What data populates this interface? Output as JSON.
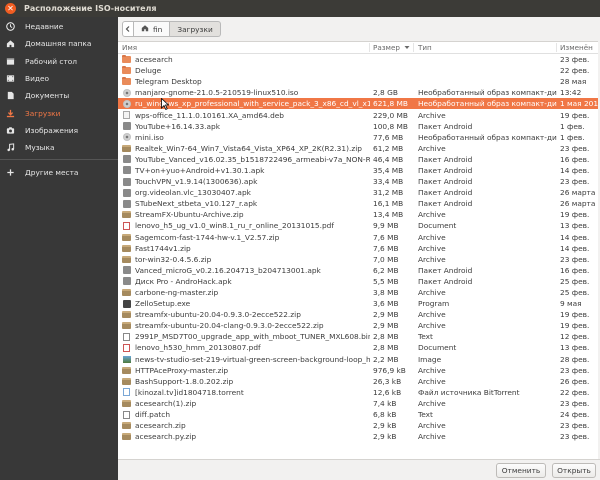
{
  "window": {
    "title": "Расположение ISO-носителя"
  },
  "sidebar": {
    "items": [
      {
        "label": "Недавние",
        "icon": "clock-icon"
      },
      {
        "label": "Домашняя папка",
        "icon": "home-icon"
      },
      {
        "label": "Рабочий стол",
        "icon": "desktop-icon"
      },
      {
        "label": "Видео",
        "icon": "video-icon"
      },
      {
        "label": "Документы",
        "icon": "documents-icon"
      },
      {
        "label": "Загрузки",
        "icon": "downloads-icon",
        "active": true
      },
      {
        "label": "Изображения",
        "icon": "camera-icon"
      },
      {
        "label": "Музыка",
        "icon": "music-icon"
      }
    ],
    "other_places": "Другие места"
  },
  "path": {
    "home": "fin",
    "current": "Загрузки"
  },
  "columns": {
    "name": "Имя",
    "size": "Размер",
    "type": "Тип",
    "date": "Изменён"
  },
  "files": [
    {
      "name": "acesearch",
      "size": "",
      "type": "",
      "date": "23 фев.",
      "icon": "folder"
    },
    {
      "name": "Deluge",
      "size": "",
      "type": "",
      "date": "22 фев.",
      "icon": "folder"
    },
    {
      "name": "Telegram Desktop",
      "size": "",
      "type": "",
      "date": "28 мая",
      "icon": "folder"
    },
    {
      "name": "manjaro-gnome-21.0.5-210519-linux510.iso",
      "size": "2,8 GB",
      "type": "Необработанный образ компакт-диска",
      "date": "13:42",
      "icon": "disc"
    },
    {
      "name": "ru_windows_xp_professional_with_service_pack_3_x86_cd_vl_x14-7…",
      "size": "621,8 MB",
      "type": "Необработанный образ компакт-диска",
      "date": "1 мая 2018",
      "icon": "disc",
      "selected": true
    },
    {
      "name": "wps-office_11.1.0.10161.XA_amd64.deb",
      "size": "229,0 MB",
      "type": "Archive",
      "date": "19 фев.",
      "icon": "file"
    },
    {
      "name": "YouTube+16.14.33.apk",
      "size": "100,8 MB",
      "type": "Пакет Android",
      "date": "1 фев.",
      "icon": "apk"
    },
    {
      "name": "mini.iso",
      "size": "77,6 MB",
      "type": "Необработанный образ компакт-диска",
      "date": "1 фев.",
      "icon": "disc"
    },
    {
      "name": "Realtek_Win7-64_Win7_Vista64_Vista_XP64_XP_2K(R2.31).zip",
      "size": "61,2 MB",
      "type": "Archive",
      "date": "23 фев.",
      "icon": "archive"
    },
    {
      "name": "YouTube_Vanced_v16.02.35_b1518722496_armeabi-v7a_NON-ROOT…",
      "size": "46,4 MB",
      "type": "Пакет Android",
      "date": "16 фев.",
      "icon": "apk"
    },
    {
      "name": "TV+on+yuo+Android+v1.30.1.apk",
      "size": "35,4 MB",
      "type": "Пакет Android",
      "date": "14 фев.",
      "icon": "apk"
    },
    {
      "name": "TouchVPN_v1.9.14(1300636).apk",
      "size": "33,4 MB",
      "type": "Пакет Android",
      "date": "23 фев.",
      "icon": "apk"
    },
    {
      "name": "org.videolan.vlc_13030407.apk",
      "size": "31,2 MB",
      "type": "Пакет Android",
      "date": "26 марта",
      "icon": "apk"
    },
    {
      "name": "STubeNext_stbeta_v10.127_r.apk",
      "size": "16,1 MB",
      "type": "Пакет Android",
      "date": "26 марта",
      "icon": "apk"
    },
    {
      "name": "StreamFX-Ubuntu-Archive.zip",
      "size": "13,4 MB",
      "type": "Archive",
      "date": "19 фев.",
      "icon": "archive"
    },
    {
      "name": "lenovo_h5_ug_v1.0_win8.1_ru_r_online_20131015.pdf",
      "size": "9,9 MB",
      "type": "Document",
      "date": "13 фев.",
      "icon": "pdf"
    },
    {
      "name": "Sagemcom-fast-1744-hw-v.1_V2.57.zip",
      "size": "7,6 MB",
      "type": "Archive",
      "date": "14 фев.",
      "icon": "archive"
    },
    {
      "name": "Fast1744v1.zip",
      "size": "7,6 MB",
      "type": "Archive",
      "date": "14 фев.",
      "icon": "archive"
    },
    {
      "name": "tor-win32-0.4.5.6.zip",
      "size": "7,0 MB",
      "type": "Archive",
      "date": "23 фев.",
      "icon": "archive"
    },
    {
      "name": "Vanced_microG_v0.2.16.204713_b204713001.apk",
      "size": "6,2 MB",
      "type": "Пакет Android",
      "date": "16 фев.",
      "icon": "apk"
    },
    {
      "name": "Диск Pro - AndroHack.apk",
      "size": "5,5 MB",
      "type": "Пакет Android",
      "date": "25 фев.",
      "icon": "apk"
    },
    {
      "name": "carbone-ng-master.zip",
      "size": "3,8 MB",
      "type": "Archive",
      "date": "25 фев.",
      "icon": "archive"
    },
    {
      "name": "ZelloSetup.exe",
      "size": "3,6 MB",
      "type": "Program",
      "date": "9 мая",
      "icon": "exe"
    },
    {
      "name": "streamfx-ubuntu-20.04-0.9.3.0-2ecce522.zip",
      "size": "2,9 MB",
      "type": "Archive",
      "date": "19 фев.",
      "icon": "archive"
    },
    {
      "name": "streamfx-ubuntu-20.04-clang-0.9.3.0-2ecce522.zip",
      "size": "2,9 MB",
      "type": "Archive",
      "date": "19 фев.",
      "icon": "archive"
    },
    {
      "name": "2991P_MSD7T00_upgrade_app_with_mboot_TUNER_MXL608.bin",
      "size": "2,8 MB",
      "type": "Text",
      "date": "12 фев.",
      "icon": "text"
    },
    {
      "name": "lenovo_h530_hmm_20130807.pdf",
      "size": "2,8 MB",
      "type": "Document",
      "date": "13 фев.",
      "icon": "pdf"
    },
    {
      "name": "news-tv-studio-set-219-virtual-green-screen-background-loop_hezmz…",
      "size": "2,2 MB",
      "type": "Image",
      "date": "28 фев.",
      "icon": "image"
    },
    {
      "name": "HTTPAceProxy-master.zip",
      "size": "976,9 kB",
      "type": "Archive",
      "date": "23 фев.",
      "icon": "archive"
    },
    {
      "name": "BashSupport-1.8.0.202.zip",
      "size": "26,3 kB",
      "type": "Archive",
      "date": "26 фев.",
      "icon": "archive"
    },
    {
      "name": "[kinozal.tv]id1804718.torrent",
      "size": "12,6 kB",
      "type": "Файл источника BitTorrent",
      "date": "22 фев.",
      "icon": "torrent"
    },
    {
      "name": "acesearch(1).zip",
      "size": "7,4 kB",
      "type": "Archive",
      "date": "23 фев.",
      "icon": "archive"
    },
    {
      "name": "diff.patch",
      "size": "6,8 kB",
      "type": "Text",
      "date": "24 фев.",
      "icon": "text"
    },
    {
      "name": "acesearch.zip",
      "size": "2,9 kB",
      "type": "Archive",
      "date": "23 фев.",
      "icon": "archive"
    },
    {
      "name": "acesearch.py.zip",
      "size": "2,9 kB",
      "type": "Archive",
      "date": "23 фев.",
      "icon": "archive"
    }
  ],
  "buttons": {
    "cancel": "Отменить",
    "open": "Открыть"
  }
}
